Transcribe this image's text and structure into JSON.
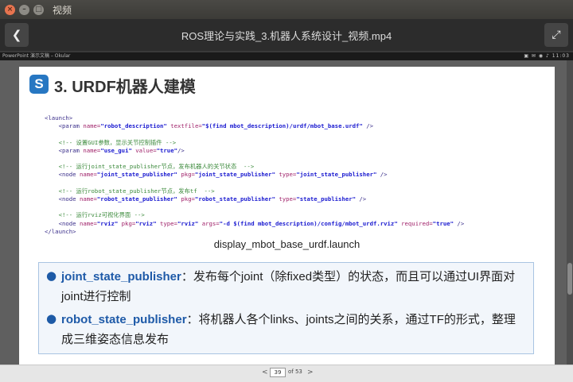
{
  "window": {
    "title": "视频"
  },
  "player": {
    "video_title": "ROS理论与实践_3.机器人系统设计_视频.mp4"
  },
  "okular_bar": {
    "label": "PowerPoint 演示文稿 – Okular",
    "clock": "11:03"
  },
  "slide": {
    "icon_letter": "S",
    "title": "3. URDF机器人建模",
    "code": {
      "launch_open": "<launch>",
      "p1_tag": "<param ",
      "p1_a1": "name=",
      "p1_v1": "\"robot_description\"",
      "p1_a2": " textfile=",
      "p1_v2": "\"$(find mbot_description)/urdf/mbot_base.urdf\"",
      "p1_end": " />",
      "c1": "<!-- 设置GUI参数，显示关节控制插件 -->",
      "p2_tag": "<param ",
      "p2_a1": "name=",
      "p2_v1": "\"use_gui\"",
      "p2_a2": " value=",
      "p2_v2": "\"true\"",
      "p2_end": "/>",
      "c2": "<!-- 运行joint_state_publisher节点，发布机器人的关节状态  -->",
      "n1_tag": "<node ",
      "n1_a1": "name=",
      "n1_v1": "\"joint_state_publisher\"",
      "n1_a2": " pkg=",
      "n1_v2": "\"joint_state_publisher\"",
      "n1_a3": " type=",
      "n1_v3": "\"joint_state_publisher\"",
      "n1_end": " />",
      "c3": "<!-- 运行robot_state_publisher节点，发布tf  -->",
      "n2_tag": "<node ",
      "n2_a1": "name=",
      "n2_v1": "\"robot_state_publisher\"",
      "n2_a2": " pkg=",
      "n2_v2": "\"robot_state_publisher\"",
      "n2_a3": " type=",
      "n2_v3": "\"state_publisher\"",
      "n2_end": " />",
      "c4": "<!-- 运行rviz可视化界面 -->",
      "n3_tag": "<node ",
      "n3_a1": "name=",
      "n3_v1": "\"rviz\"",
      "n3_a2": " pkg=",
      "n3_v2": "\"rviz\"",
      "n3_a3": " type=",
      "n3_v3": "\"rviz\"",
      "n3_a4": " args=",
      "n3_v4": "\"-d $(find mbot_description)/config/mbot_urdf.rviz\"",
      "n3_a5": " required=",
      "n3_v5": "\"true\"",
      "n3_end": " />",
      "launch_close": "</launch>"
    },
    "launch_name": "display_mbot_base_urdf.launch",
    "bullets": [
      {
        "key": "joint_state_publisher",
        "line1": "：发布每个joint（除fixed类型）的状态，而且可以通过UI界面对",
        "line2": "joint进行控制"
      },
      {
        "key": "robot_state_publisher",
        "line1": "：将机器人各个links、joints之间的关系，通过TF的形式，整理",
        "line2": "成三维姿态信息发布"
      }
    ]
  },
  "pager": {
    "current": "39",
    "of_text": "of 53"
  }
}
